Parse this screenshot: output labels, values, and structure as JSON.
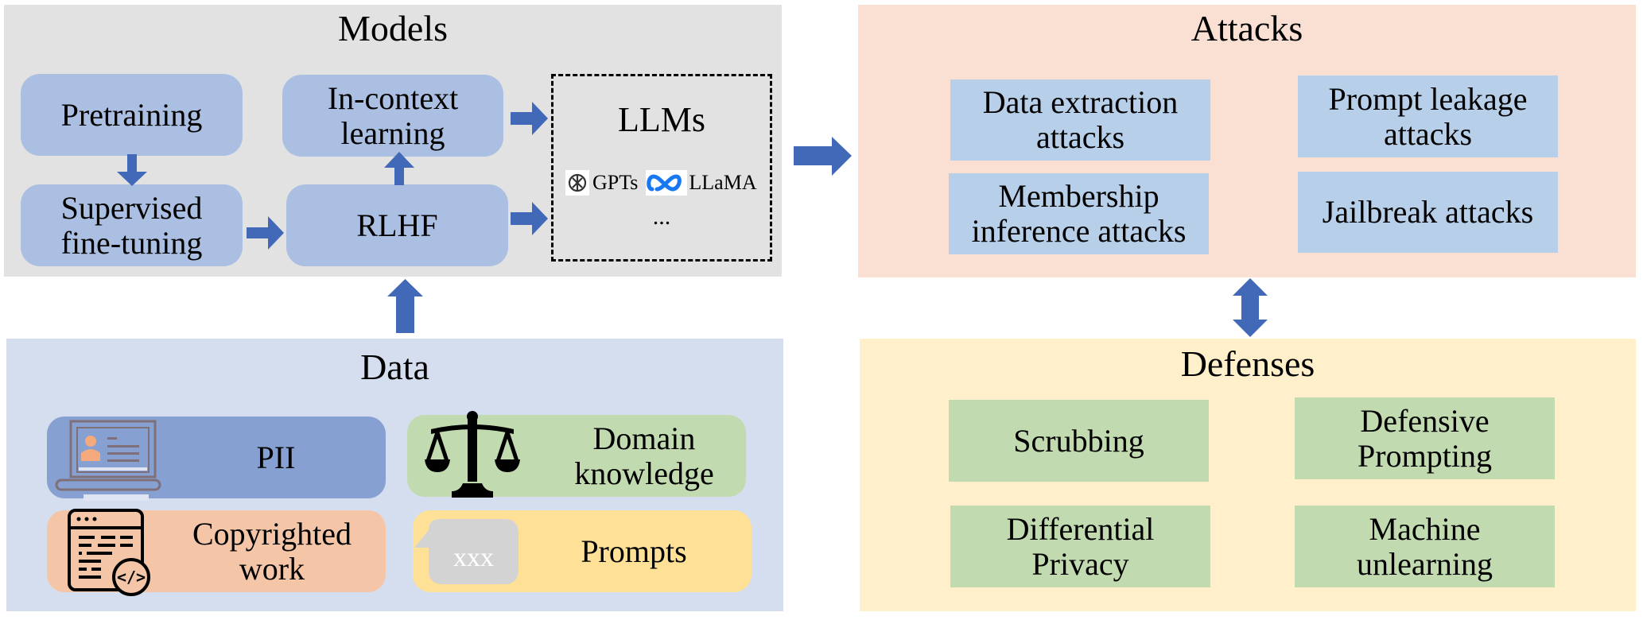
{
  "colors": {
    "models_bg": "#e2e2e2",
    "data_bg": "#d5deee",
    "attacks_bg": "#fae0d3",
    "defenses_bg": "#fff0cb",
    "model_box": "#abbfe2",
    "attack_box": "#b7cfe9",
    "defense_box": "#c1dab0",
    "pii_box": "#86a0d2",
    "domain_box": "#c1dab0",
    "copyright_box": "#f4c5a7",
    "prompts_box": "#fee196",
    "arrow": "#4169b8"
  },
  "models": {
    "title": "Models",
    "boxes": {
      "pretraining": "Pretraining",
      "sft": "Supervised\nfine-tuning",
      "icl": "In-context\nlearning",
      "rlhf": "RLHF"
    },
    "llms": {
      "title": "LLMs",
      "gpt_label": "GPTs",
      "llama_label": "LLaMA",
      "more": "..."
    }
  },
  "data": {
    "title": "Data",
    "items": {
      "pii": "PII",
      "domain": "Domain\nknowledge",
      "copyright": "Copyrighted\nwork",
      "prompts": "Prompts",
      "prompt_bubble_text": "xxx"
    }
  },
  "attacks": {
    "title": "Attacks",
    "items": {
      "data_extraction": "Data extraction\nattacks",
      "prompt_leakage": "Prompt leakage\nattacks",
      "membership": "Membership\ninference attacks",
      "jailbreak": "Jailbreak attacks"
    }
  },
  "defenses": {
    "title": "Defenses",
    "items": {
      "scrubbing": "Scrubbing",
      "defensive_prompting": "Defensive\nPrompting",
      "dp": "Differential\nPrivacy",
      "unlearning": "Machine\nunlearning"
    }
  }
}
